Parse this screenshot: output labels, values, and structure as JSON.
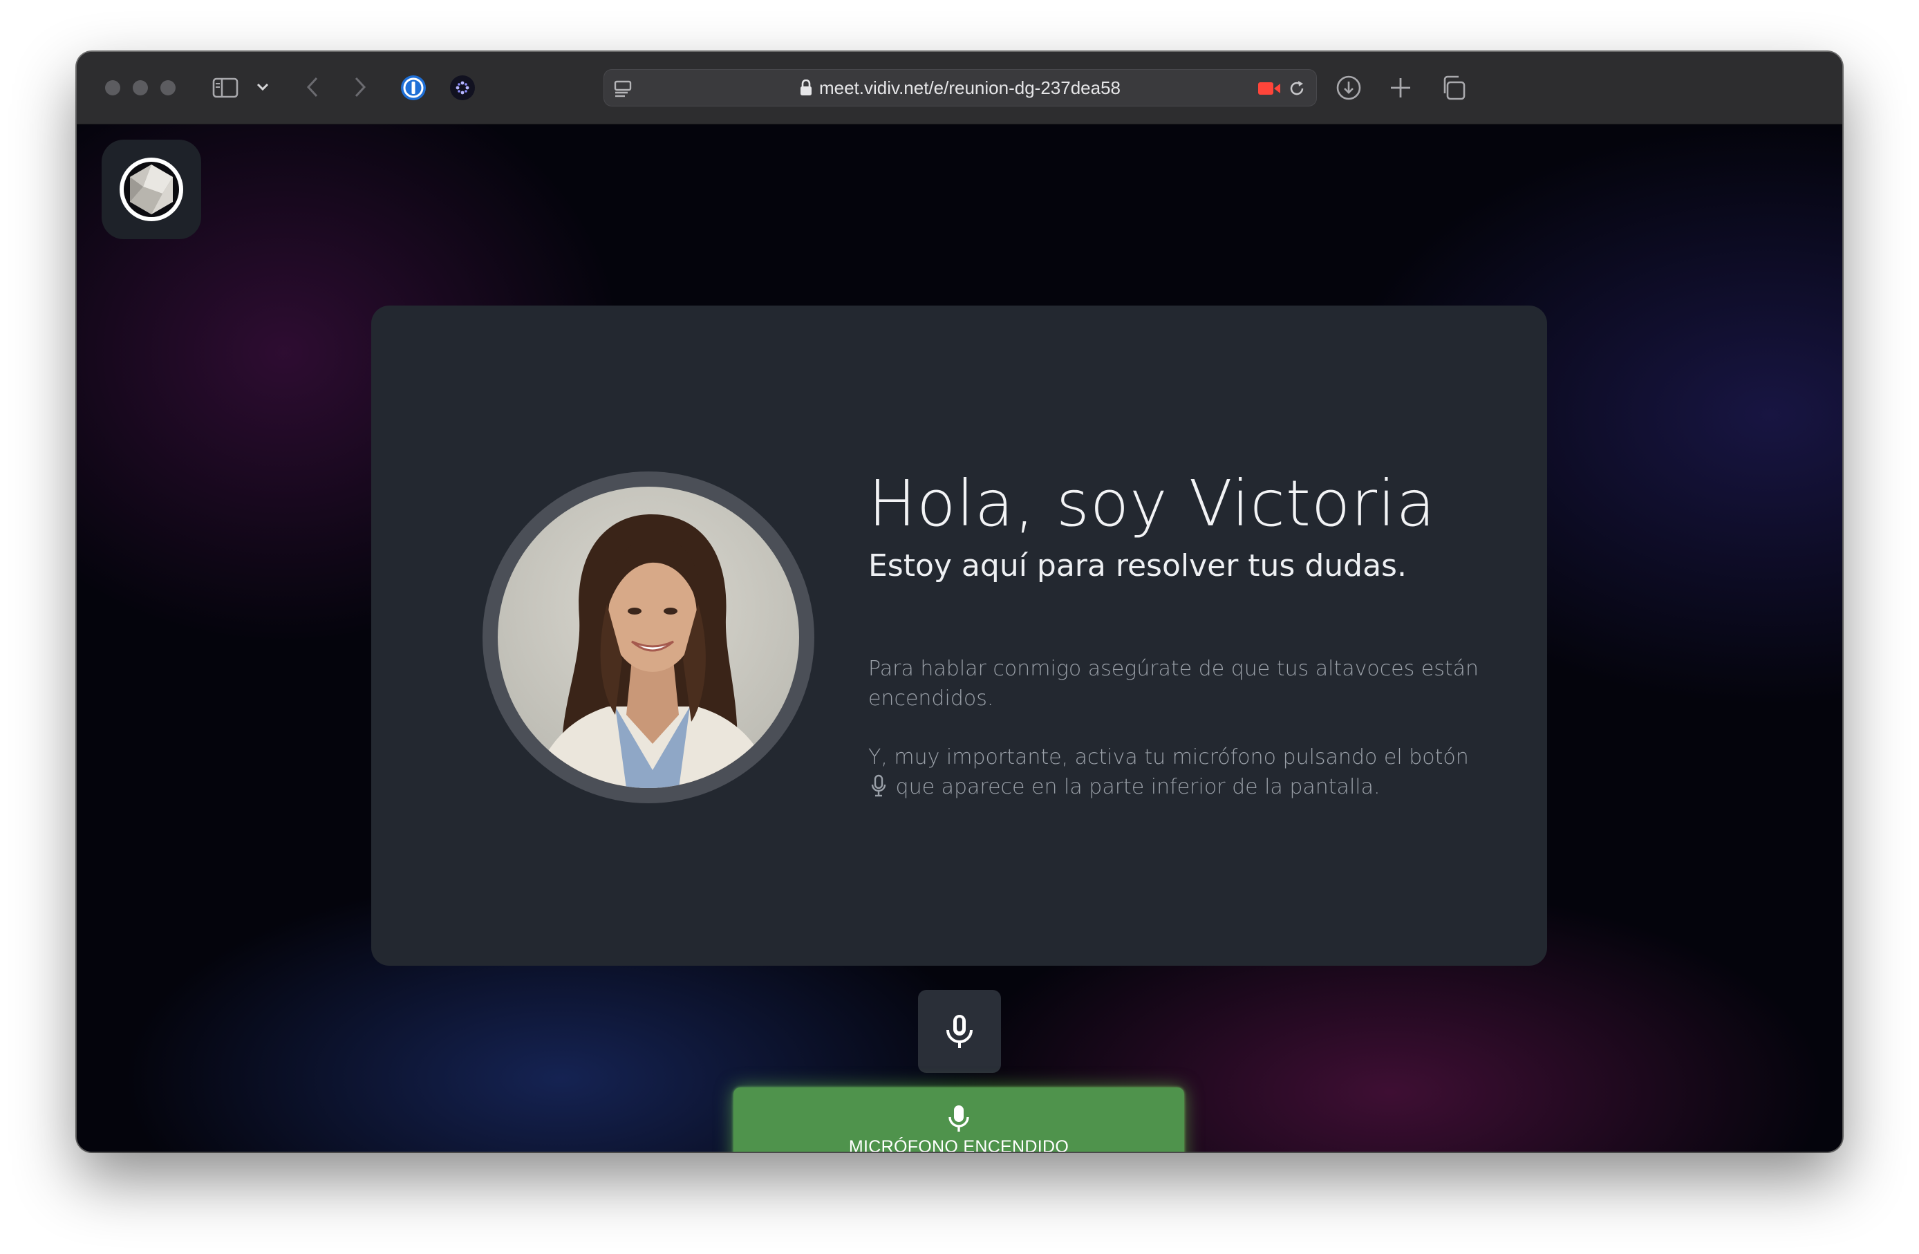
{
  "browser": {
    "url": "meet.vidiv.net/e/reunion-dg-237dea58",
    "traffic_lights": [
      "close-icon",
      "minimize-icon",
      "zoom-icon"
    ],
    "toolbar_icons": [
      "sidebar-icon",
      "chevron-down-icon",
      "back-icon",
      "forward-icon",
      "password-manager-icon",
      "extension-icon",
      "reader-icon",
      "lock-icon",
      "camera-recording-icon",
      "reload-icon",
      "download-icon",
      "new-tab-icon",
      "tabs-overview-icon"
    ],
    "colors": {
      "toolbar": "#2d2d2f",
      "recording": "#ff453a"
    }
  },
  "app": {
    "logo_icon": "hexagon-logo-icon"
  },
  "card": {
    "avatar_alt": "Victoria",
    "title": "Hola, soy Victoria",
    "subtitle": "Estoy aquí para resolver tus dudas.",
    "paragraph1": "Para hablar conmigo asegúrate de que tus altavoces están encendidos.",
    "paragraph2_part1": "Y, muy importante, activa tu micrófono pulsando el botón",
    "paragraph2_icon": "microphone-icon",
    "paragraph2_part2": "que aparece en la parte inferior de la pantalla."
  },
  "controls": {
    "mic_button_icon": "microphone-icon",
    "mic_status_label": "MICRÓFONO ENCENDIDO",
    "mic_status_color": "#4f934c"
  }
}
